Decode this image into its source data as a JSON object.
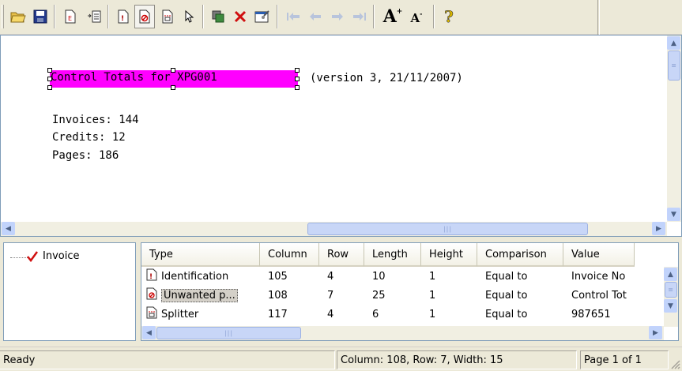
{
  "toolbar": {
    "buttons": [
      {
        "icon": "open-folder-icon"
      },
      {
        "icon": "save-icon"
      },
      {
        "icon": "field-e-icon"
      },
      {
        "icon": "field-list-icon"
      },
      {
        "icon": "identification-icon"
      },
      {
        "icon": "unwanted-icon",
        "pressed": true
      },
      {
        "icon": "splitter-icon"
      },
      {
        "icon": "pointer-icon"
      },
      {
        "icon": "copy-icon"
      },
      {
        "icon": "delete-icon"
      },
      {
        "icon": "properties-icon"
      },
      {
        "icon": "first-icon"
      },
      {
        "icon": "previous-icon"
      },
      {
        "icon": "next-icon"
      },
      {
        "icon": "last-icon"
      },
      {
        "icon": "font-larger-icon"
      },
      {
        "icon": "font-smaller-icon"
      },
      {
        "icon": "help-icon"
      }
    ]
  },
  "editor": {
    "selected_text": "Control Totals for XPG001",
    "title_rest": "(version 3, 21/11/2007)",
    "lines": [
      "Invoices: 144",
      "Credits: 12",
      "Pages: 186"
    ]
  },
  "tree": {
    "items": [
      {
        "label": "Invoice",
        "icon": "checkmark-icon"
      }
    ]
  },
  "grid": {
    "columns": [
      "Type",
      "Column",
      "Row",
      "Length",
      "Height",
      "Comparison",
      "Value"
    ],
    "rows": [
      {
        "type": "Identification",
        "icon": "identification-icon",
        "column": "105",
        "row": "4",
        "length": "10",
        "height": "1",
        "comparison": "Equal to",
        "value": "Invoice No"
      },
      {
        "type": "Unwanted p...",
        "icon": "unwanted-icon",
        "column": "108",
        "row": "7",
        "length": "25",
        "height": "1",
        "comparison": "Equal to",
        "value": "Control Tot",
        "selected": true
      },
      {
        "type": "Splitter",
        "icon": "splitter-icon",
        "column": "117",
        "row": "4",
        "length": "6",
        "height": "1",
        "comparison": "Equal to",
        "value": "987651"
      }
    ]
  },
  "status": {
    "ready": "Ready",
    "position": "Column: 108, Row: 7, Width: 15",
    "page": "Page 1 of 1"
  }
}
